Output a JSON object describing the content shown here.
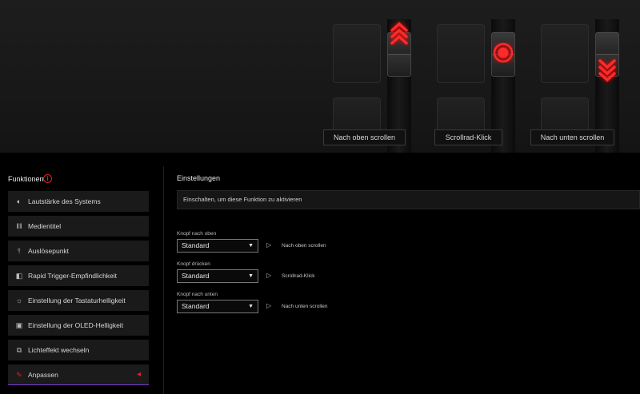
{
  "preview": {
    "labels": {
      "up": "Nach oben scrollen",
      "click": "Scrollrad-Klick",
      "down": "Nach unten scrollen"
    },
    "accent_color": "#ff2020"
  },
  "sidebar": {
    "title": "Funktionen",
    "info_icon": "i",
    "items": [
      {
        "label": "Lautstärke des Systems",
        "icon": "speaker-icon"
      },
      {
        "label": "Medientitel",
        "icon": "media-icon"
      },
      {
        "label": "Auslösepunkt",
        "icon": "actuation-icon"
      },
      {
        "label": "Rapid Trigger-Empfindlichkeit",
        "icon": "rapid-trigger-icon"
      },
      {
        "label": "Einstellung der Tastaturhelligkeit",
        "icon": "brightness-icon"
      },
      {
        "label": "Einstellung der OLED-Helligkeit",
        "icon": "oled-icon"
      },
      {
        "label": "Lichteffekt wechseln",
        "icon": "light-effect-icon"
      },
      {
        "label": "Anpassen",
        "icon": "customize-icon",
        "active": true
      }
    ]
  },
  "settings": {
    "title": "Einstellungen",
    "enable_text": "Einschalten, um diese Funktion zu aktivieren",
    "rows": [
      {
        "label": "Knopf nach oben",
        "value": "Standard",
        "action": "Nach oben scrollen"
      },
      {
        "label": "Knopf drücken",
        "value": "Standard",
        "action": "Scrollrad-Klick"
      },
      {
        "label": "Knopf nach unten",
        "value": "Standard",
        "action": "Nach unten scrollen"
      }
    ]
  }
}
